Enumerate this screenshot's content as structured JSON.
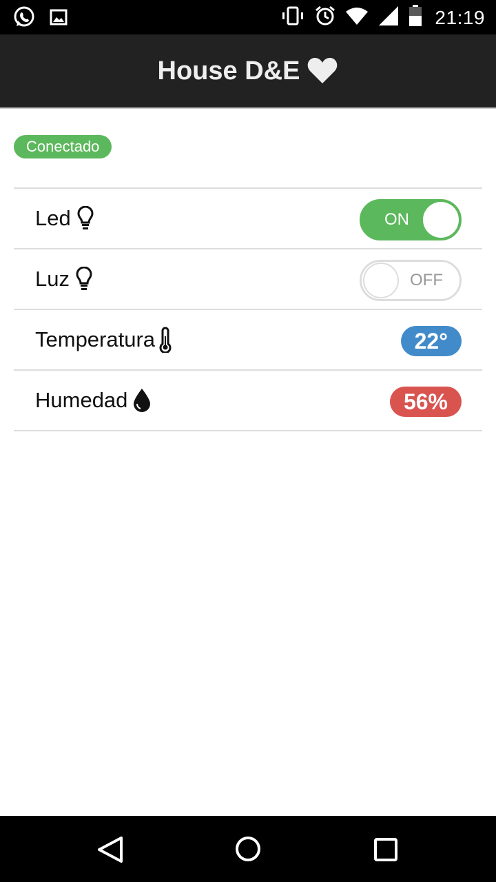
{
  "status_bar": {
    "time": "21:19",
    "left_icons": [
      "whatsapp-icon",
      "image-icon"
    ],
    "right_icons": [
      "vibrate-icon",
      "alarm-icon",
      "wifi-icon",
      "cellular-signal-icon",
      "battery-icon"
    ]
  },
  "app_bar": {
    "title": "House D&E",
    "icon": "heart-icon"
  },
  "connection": {
    "label": "Conectado",
    "color": "#5cb85c"
  },
  "rows": [
    {
      "label": "Led",
      "icon": "lightbulb-icon",
      "control": "toggle",
      "state": "ON"
    },
    {
      "label": "Luz",
      "icon": "lightbulb-icon",
      "control": "toggle",
      "state": "OFF"
    },
    {
      "label": "Temperatura",
      "icon": "thermometer-icon",
      "control": "badge",
      "value": "22°",
      "color": "#428bca"
    },
    {
      "label": "Humedad",
      "icon": "water-drop-icon",
      "control": "badge",
      "value": "56%",
      "color": "#d9534f"
    }
  ],
  "nav_bar": {
    "buttons": [
      "back-icon",
      "home-icon",
      "recents-icon"
    ]
  }
}
